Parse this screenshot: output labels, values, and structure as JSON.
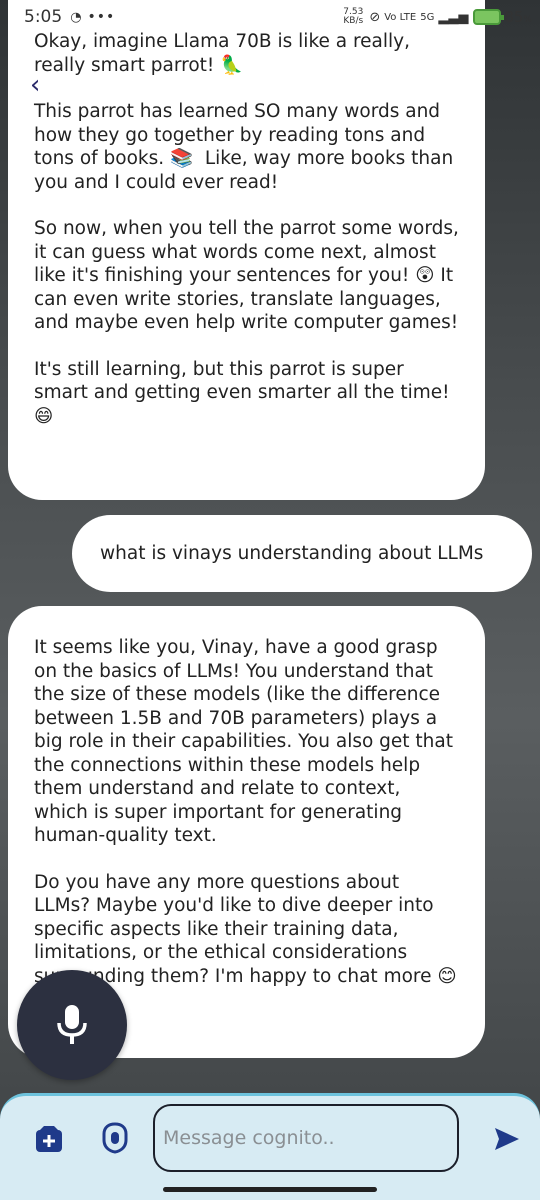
{
  "status_bar": {
    "time": "5:05",
    "dots": "•••",
    "net_speed_value": "7.53",
    "net_speed_unit": "KB/s",
    "volte": "Vo LTE",
    "network": "5G",
    "battery_percent": "85",
    "battery_percent_sign": "%"
  },
  "chat": {
    "bot_message_1": {
      "paragraphs": [
        "Okay, imagine Llama 70B is like a really, really smart parrot! 🦜",
        "This parrot has learned SO many words and how they go together by reading tons and tons of books. 📚  Like, way more books than you and I could ever read!",
        "So now, when you tell the parrot some words, it can guess what words come next, almost like it's finishing your sentences for you! 😲 It can even write stories, translate languages, and maybe even help write computer games!",
        "It's still learning, but this parrot is super smart and getting even smarter all the time! 😄"
      ]
    },
    "user_message": "what is vinays understanding about LLMs",
    "bot_message_2": {
      "paragraphs": [
        "It seems like you, Vinay, have a good grasp on the basics of LLMs! You understand that the size of these models (like the difference between 1.5B and 70B parameters) plays a big role in their capabilities. You also get that the connections within these models help them understand and relate to context, which is super important for generating human-quality text.",
        "Do you have any more questions about LLMs? Maybe you'd like to dive deeper into specific aspects like their training data, limitations, or the ethical considerations surrounding them? I'm happy to chat more 😊"
      ]
    }
  },
  "composer": {
    "placeholder": "Message cognito.."
  },
  "icons": {
    "back": "back-chevron-icon",
    "mic": "microphone-icon",
    "attach": "add-attachment-icon",
    "shield": "shield-icon",
    "send": "send-icon"
  },
  "colors": {
    "composer_bg": "#d7ebf3",
    "composer_border": "#6cc2dc",
    "fab": "#2c3040",
    "battery": "#7bc560"
  }
}
